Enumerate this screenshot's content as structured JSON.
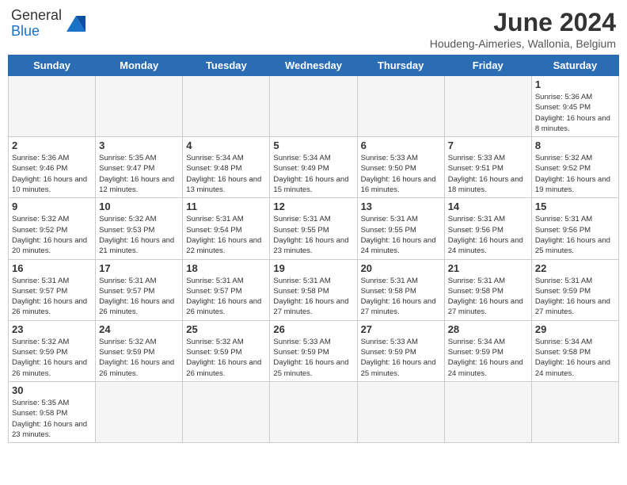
{
  "logo": {
    "text_general": "General",
    "text_blue": "Blue"
  },
  "header": {
    "month_year": "June 2024",
    "location": "Houdeng-Aimeries, Wallonia, Belgium"
  },
  "weekdays": [
    "Sunday",
    "Monday",
    "Tuesday",
    "Wednesday",
    "Thursday",
    "Friday",
    "Saturday"
  ],
  "days": [
    {
      "num": "",
      "info": ""
    },
    {
      "num": "",
      "info": ""
    },
    {
      "num": "",
      "info": ""
    },
    {
      "num": "",
      "info": ""
    },
    {
      "num": "",
      "info": ""
    },
    {
      "num": "",
      "info": ""
    },
    {
      "num": "1",
      "info": "Sunrise: 5:36 AM\nSunset: 9:45 PM\nDaylight: 16 hours\nand 8 minutes."
    },
    {
      "num": "2",
      "info": "Sunrise: 5:36 AM\nSunset: 9:46 PM\nDaylight: 16 hours\nand 10 minutes."
    },
    {
      "num": "3",
      "info": "Sunrise: 5:35 AM\nSunset: 9:47 PM\nDaylight: 16 hours\nand 12 minutes."
    },
    {
      "num": "4",
      "info": "Sunrise: 5:34 AM\nSunset: 9:48 PM\nDaylight: 16 hours\nand 13 minutes."
    },
    {
      "num": "5",
      "info": "Sunrise: 5:34 AM\nSunset: 9:49 PM\nDaylight: 16 hours\nand 15 minutes."
    },
    {
      "num": "6",
      "info": "Sunrise: 5:33 AM\nSunset: 9:50 PM\nDaylight: 16 hours\nand 16 minutes."
    },
    {
      "num": "7",
      "info": "Sunrise: 5:33 AM\nSunset: 9:51 PM\nDaylight: 16 hours\nand 18 minutes."
    },
    {
      "num": "8",
      "info": "Sunrise: 5:32 AM\nSunset: 9:52 PM\nDaylight: 16 hours\nand 19 minutes."
    },
    {
      "num": "9",
      "info": "Sunrise: 5:32 AM\nSunset: 9:52 PM\nDaylight: 16 hours\nand 20 minutes."
    },
    {
      "num": "10",
      "info": "Sunrise: 5:32 AM\nSunset: 9:53 PM\nDaylight: 16 hours\nand 21 minutes."
    },
    {
      "num": "11",
      "info": "Sunrise: 5:31 AM\nSunset: 9:54 PM\nDaylight: 16 hours\nand 22 minutes."
    },
    {
      "num": "12",
      "info": "Sunrise: 5:31 AM\nSunset: 9:55 PM\nDaylight: 16 hours\nand 23 minutes."
    },
    {
      "num": "13",
      "info": "Sunrise: 5:31 AM\nSunset: 9:55 PM\nDaylight: 16 hours\nand 24 minutes."
    },
    {
      "num": "14",
      "info": "Sunrise: 5:31 AM\nSunset: 9:56 PM\nDaylight: 16 hours\nand 24 minutes."
    },
    {
      "num": "15",
      "info": "Sunrise: 5:31 AM\nSunset: 9:56 PM\nDaylight: 16 hours\nand 25 minutes."
    },
    {
      "num": "16",
      "info": "Sunrise: 5:31 AM\nSunset: 9:57 PM\nDaylight: 16 hours\nand 26 minutes."
    },
    {
      "num": "17",
      "info": "Sunrise: 5:31 AM\nSunset: 9:57 PM\nDaylight: 16 hours\nand 26 minutes."
    },
    {
      "num": "18",
      "info": "Sunrise: 5:31 AM\nSunset: 9:57 PM\nDaylight: 16 hours\nand 26 minutes."
    },
    {
      "num": "19",
      "info": "Sunrise: 5:31 AM\nSunset: 9:58 PM\nDaylight: 16 hours\nand 27 minutes."
    },
    {
      "num": "20",
      "info": "Sunrise: 5:31 AM\nSunset: 9:58 PM\nDaylight: 16 hours\nand 27 minutes."
    },
    {
      "num": "21",
      "info": "Sunrise: 5:31 AM\nSunset: 9:58 PM\nDaylight: 16 hours\nand 27 minutes."
    },
    {
      "num": "22",
      "info": "Sunrise: 5:31 AM\nSunset: 9:59 PM\nDaylight: 16 hours\nand 27 minutes."
    },
    {
      "num": "23",
      "info": "Sunrise: 5:32 AM\nSunset: 9:59 PM\nDaylight: 16 hours\nand 26 minutes."
    },
    {
      "num": "24",
      "info": "Sunrise: 5:32 AM\nSunset: 9:59 PM\nDaylight: 16 hours\nand 26 minutes."
    },
    {
      "num": "25",
      "info": "Sunrise: 5:32 AM\nSunset: 9:59 PM\nDaylight: 16 hours\nand 26 minutes."
    },
    {
      "num": "26",
      "info": "Sunrise: 5:33 AM\nSunset: 9:59 PM\nDaylight: 16 hours\nand 25 minutes."
    },
    {
      "num": "27",
      "info": "Sunrise: 5:33 AM\nSunset: 9:59 PM\nDaylight: 16 hours\nand 25 minutes."
    },
    {
      "num": "28",
      "info": "Sunrise: 5:34 AM\nSunset: 9:59 PM\nDaylight: 16 hours\nand 24 minutes."
    },
    {
      "num": "29",
      "info": "Sunrise: 5:34 AM\nSunset: 9:58 PM\nDaylight: 16 hours\nand 24 minutes."
    },
    {
      "num": "30",
      "info": "Sunrise: 5:35 AM\nSunset: 9:58 PM\nDaylight: 16 hours\nand 23 minutes."
    },
    {
      "num": "",
      "info": ""
    },
    {
      "num": "",
      "info": ""
    },
    {
      "num": "",
      "info": ""
    },
    {
      "num": "",
      "info": ""
    },
    {
      "num": "",
      "info": ""
    },
    {
      "num": "",
      "info": ""
    }
  ]
}
